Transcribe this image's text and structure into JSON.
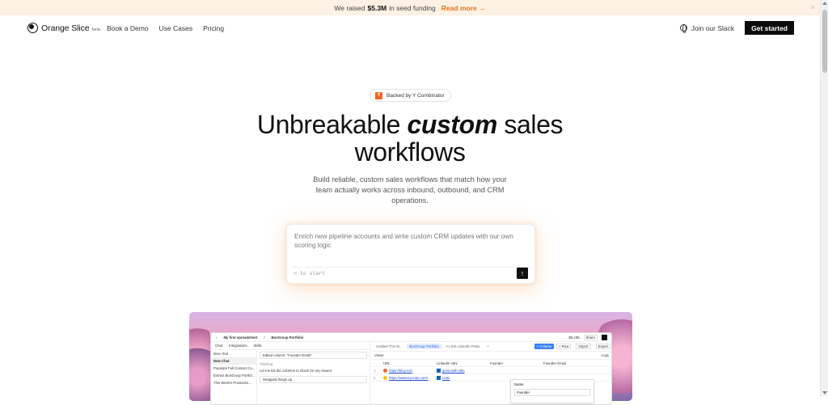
{
  "announcement": {
    "prefix": "We raised",
    "amount": "$5.3M",
    "suffix": "in seed funding",
    "link": "Read more →",
    "close": "×"
  },
  "nav": {
    "brand": "Orange Slice",
    "brand_tag": "beta",
    "links": [
      "Book a Demo",
      "Use Cases",
      "Pricing"
    ],
    "slack": "Join our Slack",
    "cta": "Get started"
  },
  "hero": {
    "badge_letter": "Y",
    "badge": "Backed by Y Combinator",
    "title_pre": "Unbreakable",
    "title_em": "custom",
    "title_post": "sales",
    "title_line2": "workflows",
    "subtitle": "Build reliable, custom sales workflows that match how your team actually works across inbound, outbound, and CRM operations."
  },
  "prompt": {
    "text": "Enrich new pipeline accounts and write custom CRM updates with our own scoring logic",
    "hint": "⏎ to start",
    "send_icon": "↑"
  },
  "app": {
    "breadcrumb_back": "‹",
    "spreadsheet": "My first spreadsheet",
    "sep": "/",
    "sheet": "BoxGroup Portfolio",
    "credits": "$5,198",
    "share": "Share",
    "left_tabs": [
      "Chat",
      "Integrations",
      "Skills"
    ],
    "new_chat": "New chat",
    "chat_list": [
      "New Chat",
      "Populate Full Contact Co...",
      "Extract BoxGroup Portfol...",
      "This Week's Productivi..."
    ],
    "chat_bubble": "Edited column: \"Founder Email\"",
    "thinking": "Thinking",
    "message": "Let me list the columns to check for any issues:",
    "wrapped": "Wrapped things up",
    "tabs": [
      "Untitled This W...",
      "BoxGroup Portfolio",
      "AI 100 LinkedIn Posts",
      "+"
    ],
    "column_btn": "+ Column",
    "row_btn": "+ Row",
    "import_btn": "Import",
    "export_btn": "Export",
    "views": "Views",
    "logs": "Logs",
    "columns": [
      "",
      "URL",
      "LinkedIn URL",
      "Founder",
      "Founder Email"
    ],
    "rows": [
      {
        "n": "1",
        "url": "https://bloy.run/",
        "li": "grow-with-vibe"
      },
      {
        "n": "2",
        "url": "https://www.trycrate.com/",
        "li": "crate"
      }
    ],
    "popover_title": "Name",
    "popover_field": "Founder"
  }
}
